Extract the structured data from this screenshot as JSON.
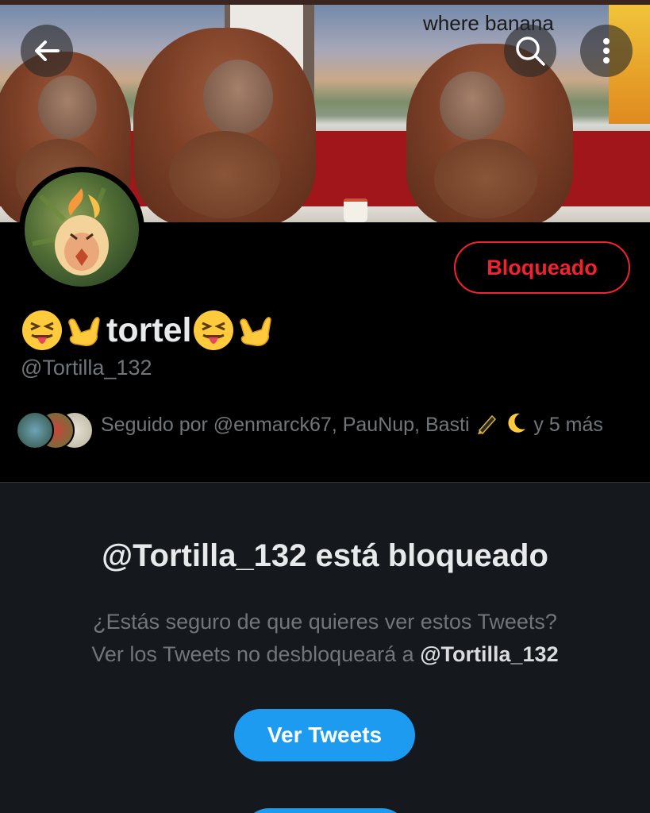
{
  "banner": {
    "meme_caption": "where banana",
    "back_icon": "arrow-left-icon",
    "search_icon": "search-icon",
    "more_icon": "more-vertical-icon"
  },
  "profile": {
    "display_name": "tortel",
    "handle": "@Tortilla_132",
    "blocked_button_label": "Bloqueado",
    "followed_by_text": "Seguido por @enmarck67, PauNup, Basti",
    "followed_by_suffix": "y 5 más"
  },
  "blocked_notice": {
    "title": "@Tortilla_132 está bloqueado",
    "line1": "¿Estás seguro de que quieres ver estos Tweets?",
    "line2_prefix": "Ver los Tweets no desbloqueará a",
    "line2_handle": "@Tortilla_132",
    "view_button_label": "Ver Tweets"
  },
  "colors": {
    "background": "#000000",
    "section_background": "#15181c",
    "accent_blue": "#1d9bf0",
    "blocked_red": "#f4212e",
    "muted_text": "#71767b"
  }
}
